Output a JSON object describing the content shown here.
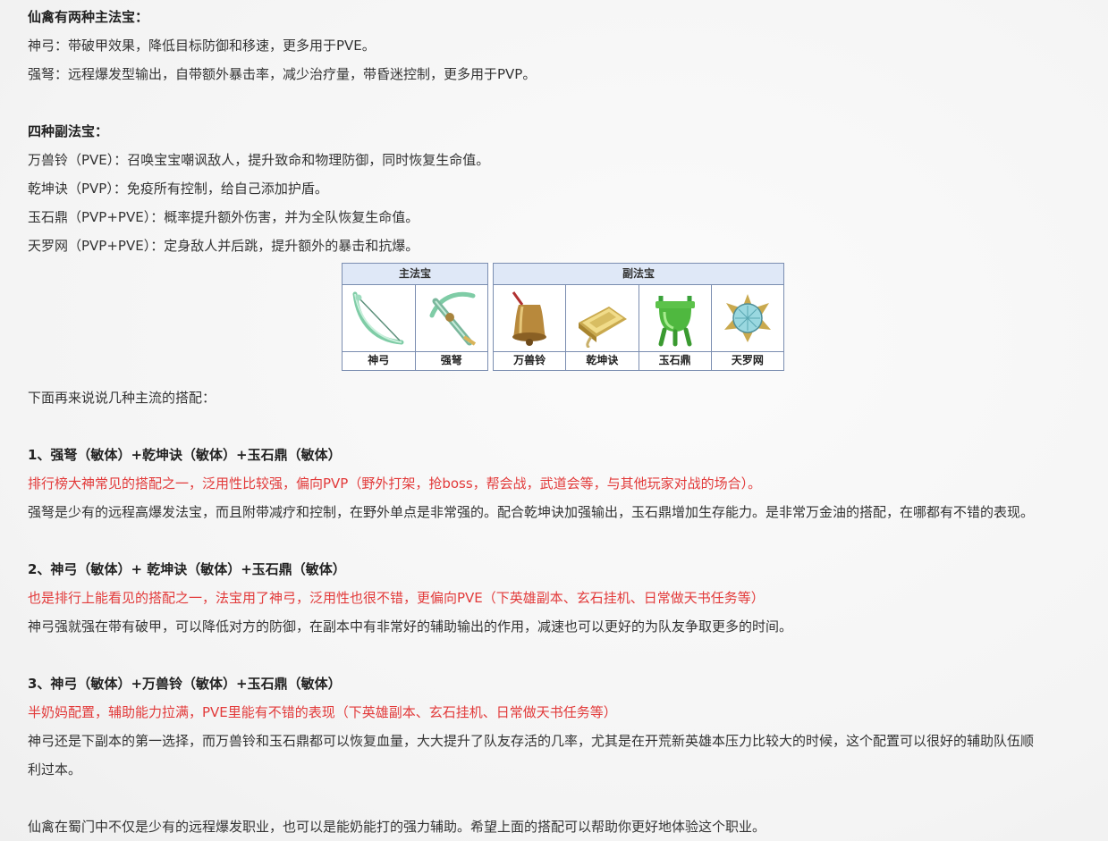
{
  "sections": {
    "main_title": "仙禽有两种主法宝：",
    "main_items": [
      "神弓：带破甲效果，降低目标防御和移速，更多用于PVE。",
      "强弩：远程爆发型输出，自带额外暴击率，减少治疗量，带昏迷控制，更多用于PVP。"
    ],
    "sub_title": "四种副法宝：",
    "sub_items": [
      "万兽铃（PVE）：召唤宝宝嘲讽敌人，提升致命和物理防御，同时恢复生命值。",
      "乾坤诀（PVP）：免疫所有控制，给自己添加护盾。",
      "玉石鼎（PVP+PVE）：概率提升额外伤害，并为全队恢复生命值。",
      "天罗网（PVP+PVE）：定身敌人并后跳，提升额外的暴击和抗爆。"
    ]
  },
  "table": {
    "main_header": "主法宝",
    "sub_header": "副法宝",
    "main_items": [
      {
        "label": "神弓",
        "icon": "bow-icon"
      },
      {
        "label": "强弩",
        "icon": "crossbow-icon"
      }
    ],
    "sub_items": [
      {
        "label": "万兽铃",
        "icon": "bell-icon"
      },
      {
        "label": "乾坤诀",
        "icon": "scroll-book-icon"
      },
      {
        "label": "玉石鼎",
        "icon": "jade-cauldron-icon"
      },
      {
        "label": "天罗网",
        "icon": "net-star-icon"
      }
    ]
  },
  "intro": "下面再来说说几种主流的搭配：",
  "combos": [
    {
      "title": "1、强弩（敏体）+乾坤诀（敏体）+玉石鼎（敏体）",
      "highlight": "排行榜大神常见的搭配之一，泛用性比较强，偏向PVP（野外打架，抢boss，帮会战，武道会等，与其他玩家对战的场合）。",
      "desc": "强弩是少有的远程高爆发法宝，而且附带减疗和控制，在野外单点是非常强的。配合乾坤诀加强输出，玉石鼎增加生存能力。是非常万金油的搭配，在哪都有不错的表现。"
    },
    {
      "title": "2、神弓（敏体）+ 乾坤诀（敏体）+玉石鼎（敏体）",
      "highlight": "也是排行上能看见的搭配之一，法宝用了神弓，泛用性也很不错，更偏向PVE（下英雄副本、玄石挂机、日常做天书任务等）",
      "desc": "神弓强就强在带有破甲，可以降低对方的防御，在副本中有非常好的辅助输出的作用，减速也可以更好的为队友争取更多的时间。"
    },
    {
      "title": "3、神弓（敏体）+万兽铃（敏体）+玉石鼎（敏体）",
      "highlight": "半奶妈配置，辅助能力拉满，PVE里能有不错的表现（下英雄副本、玄石挂机、日常做天书任务等）",
      "desc": "神弓还是下副本的第一选择，而万兽铃和玉石鼎都可以恢复血量，大大提升了队友存活的几率，尤其是在开荒新英雄本压力比较大的时候，这个配置可以很好的辅助队伍顺",
      "desc_cont": "利过本。"
    }
  ],
  "outro": "仙禽在蜀门中不仅是少有的远程爆发职业，也可以是能奶能打的强力辅助。希望上面的搭配可以帮助你更好地体验这个职业。",
  "colors": {
    "text": "#333333",
    "highlight": "#e23a3a",
    "table_header_bg": "#dfe8f7",
    "table_border": "#7a8db0"
  }
}
